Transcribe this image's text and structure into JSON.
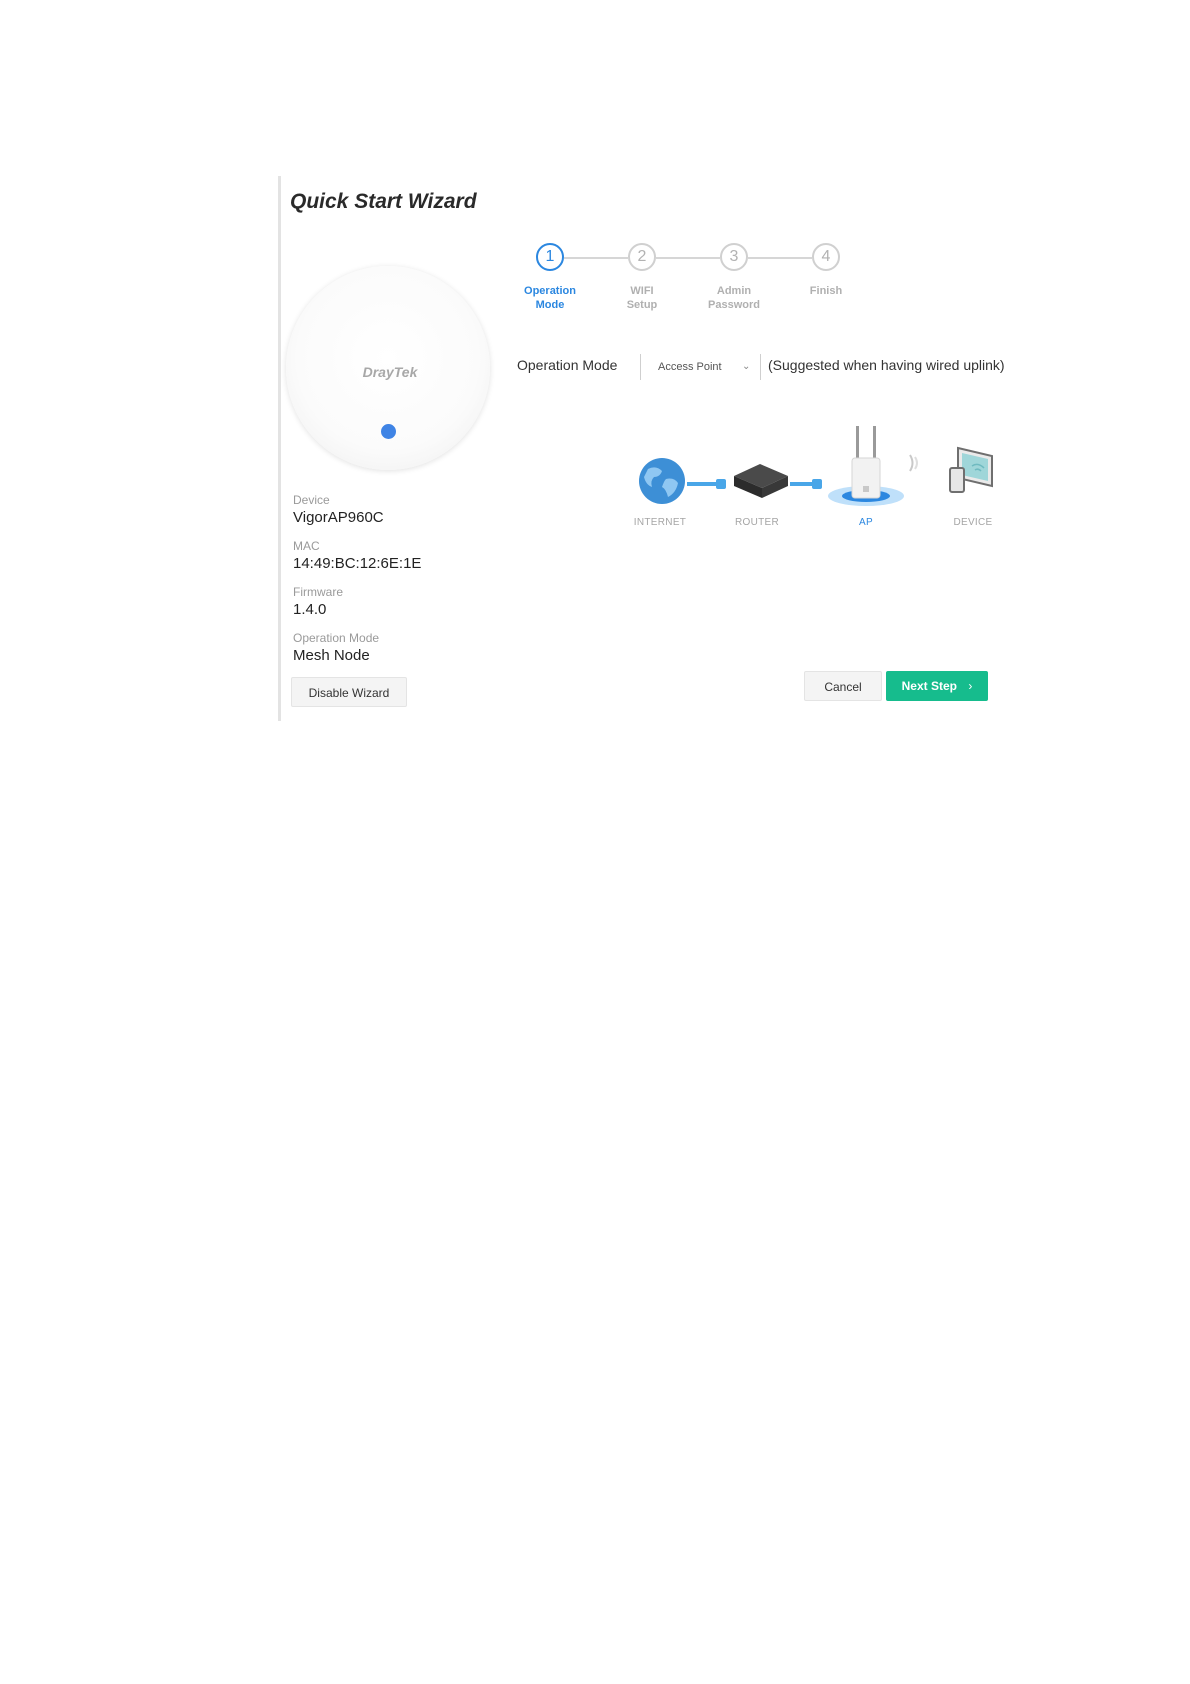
{
  "wizard": {
    "title": "Quick Start Wizard"
  },
  "device": {
    "brand": "DrayTek",
    "info": [
      {
        "label": "Device",
        "value": "VigorAP960C"
      },
      {
        "label": "MAC",
        "value": "14:49:BC:12:6E:1E"
      },
      {
        "label": "Firmware",
        "value": "1.4.0"
      },
      {
        "label": "Operation Mode",
        "value": "Mesh Node"
      }
    ],
    "disable_wizard_label": "Disable Wizard"
  },
  "steps": [
    {
      "number": "1",
      "line1": "Operation",
      "line2": "Mode",
      "active": true
    },
    {
      "number": "2",
      "line1": "WIFI",
      "line2": "Setup",
      "active": false
    },
    {
      "number": "3",
      "line1": "Admin",
      "line2": "Password",
      "active": false
    },
    {
      "number": "4",
      "line1": "Finish",
      "line2": "",
      "active": false
    }
  ],
  "operation_mode": {
    "label": "Operation Mode",
    "selected": "Access Point",
    "hint": "(Suggested when having wired uplink)"
  },
  "topology": {
    "labels": [
      "INTERNET",
      "ROUTER",
      "AP",
      "DEVICE"
    ]
  },
  "actions": {
    "cancel_label": "Cancel",
    "next_label": "Next Step",
    "next_chevron": "›"
  },
  "colors": {
    "accent_blue": "#2b87e0",
    "primary_green": "#16bc8d",
    "led_blue": "#3f84e5"
  }
}
